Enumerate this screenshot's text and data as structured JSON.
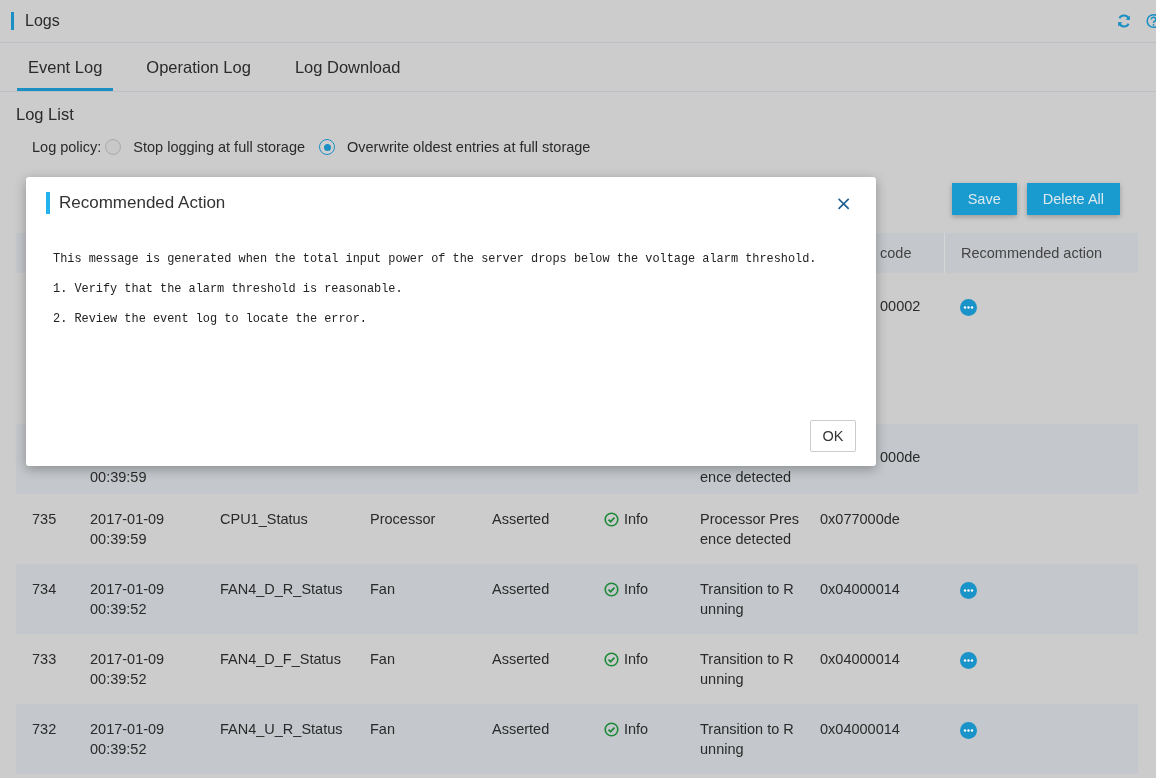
{
  "header": {
    "title": "Logs"
  },
  "tabs": [
    {
      "label": "Event Log",
      "selected": true
    },
    {
      "label": "Operation Log",
      "selected": false
    },
    {
      "label": "Log Download",
      "selected": false
    }
  ],
  "section_title": "Log List",
  "log_policy": {
    "label": "Log policy:",
    "options": [
      {
        "label": "Stop logging at full storage",
        "selected": false
      },
      {
        "label": "Overwrite oldest entries at full storage",
        "selected": true
      }
    ]
  },
  "buttons": [
    "Save",
    "Delete All"
  ],
  "table": {
    "columns": [
      {
        "label": "code"
      },
      {
        "label": "Recommended action"
      }
    ],
    "rows": [
      {
        "code": "00002",
        "has_action": true
      },
      {
        "time": "00:39:59",
        "description": [
          "ence detected"
        ],
        "code": "000de",
        "has_action": false
      },
      {
        "id": "735",
        "date": "2017-01-09",
        "time": "00:39:59",
        "sensor": "CPU1_Status",
        "type": "Processor",
        "state": "Asserted",
        "severity": "Info",
        "description": [
          "Processor Pres",
          "ence detected"
        ],
        "code": "0x077000de",
        "has_action": false
      },
      {
        "id": "734",
        "date": "2017-01-09",
        "time": "00:39:52",
        "sensor": "FAN4_D_R_Status",
        "type": "Fan",
        "state": "Asserted",
        "severity": "Info",
        "description": [
          "Transition to R",
          "unning"
        ],
        "code": "0x04000014",
        "has_action": true
      },
      {
        "id": "733",
        "date": "2017-01-09",
        "time": "00:39:52",
        "sensor": "FAN4_D_F_Status",
        "type": "Fan",
        "state": "Asserted",
        "severity": "Info",
        "description": [
          "Transition to R",
          "unning"
        ],
        "code": "0x04000014",
        "has_action": true
      },
      {
        "id": "732",
        "date": "2017-01-09",
        "time": "00:39:52",
        "sensor": "FAN4_U_R_Status",
        "type": "Fan",
        "state": "Asserted",
        "severity": "Info",
        "description": [
          "Transition to R",
          "unning"
        ],
        "code": "0x04000014",
        "has_action": true
      }
    ]
  },
  "dialog": {
    "title": "Recommended Action",
    "close": "×",
    "lines": [
      "This message is generated when the total input power of the server drops below the voltage alarm threshold.",
      "1. Verify that the alarm threshold is reasonable.",
      "2. Review the event log to locate the error."
    ],
    "ok": "OK"
  }
}
